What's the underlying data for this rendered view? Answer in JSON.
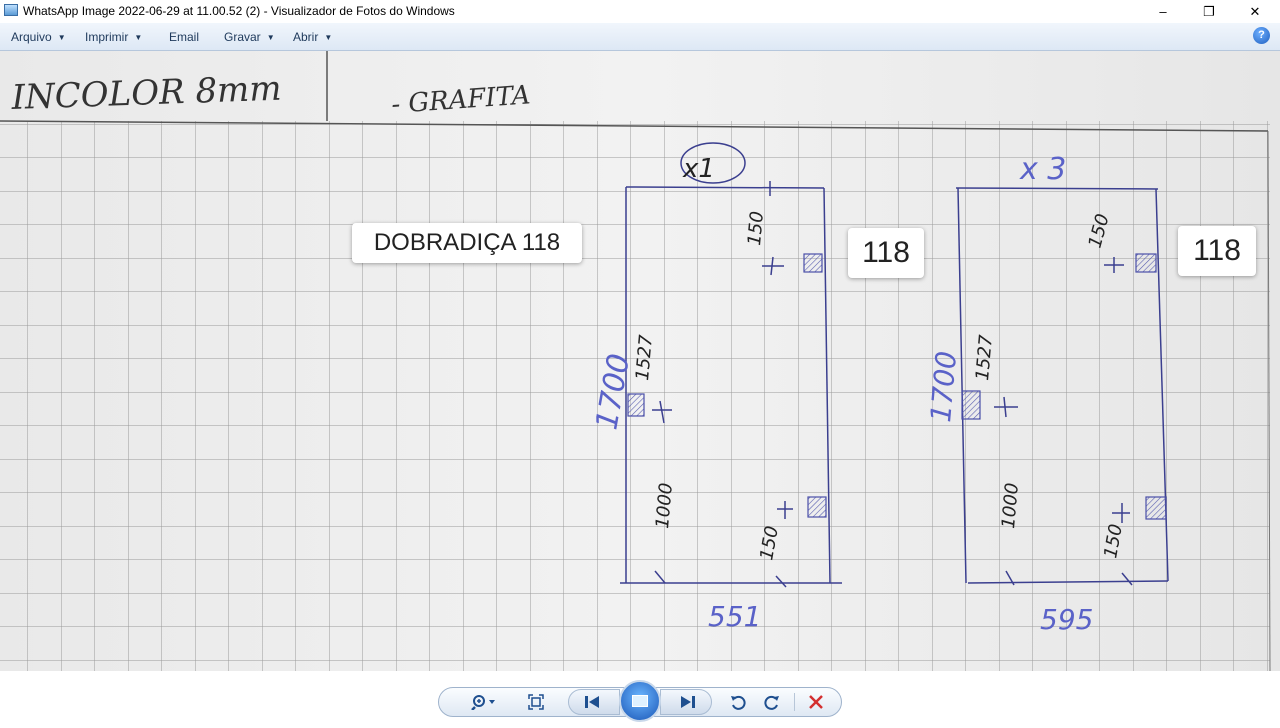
{
  "window": {
    "title": "WhatsApp Image 2022-06-29 at 11.00.52 (2) - Visualizador de Fotos do Windows",
    "minimize_glyph": "–",
    "maximize_glyph": "❐",
    "close_glyph": "✕"
  },
  "menu": {
    "items": [
      {
        "label": "Arquivo",
        "has_arrow": true
      },
      {
        "label": "Imprimir",
        "has_arrow": true
      },
      {
        "label": "Email",
        "has_arrow": false
      },
      {
        "label": "Gravar",
        "has_arrow": true
      },
      {
        "label": "Abrir",
        "has_arrow": true
      }
    ],
    "help_label": "?"
  },
  "photo": {
    "handwriting": {
      "header_left": "INCOLOR 8mm",
      "header_right": "- GRAFITA",
      "qty_left": "x1",
      "qty_right": "x 3",
      "left_panel": {
        "height": "1700",
        "width": "551",
        "dim_top": "150",
        "dim_mid": "1527",
        "dim_low": "1000",
        "dim_bottom": "150"
      },
      "right_panel": {
        "height": "1700",
        "width": "595",
        "dim_top": "150",
        "dim_mid": "1527",
        "dim_low": "1000",
        "dim_bottom": "150"
      }
    },
    "labels": {
      "hinge": "DOBRADIÇA 118",
      "hinge_code_left": "118",
      "hinge_code_right": "118"
    }
  },
  "controls": {
    "zoom_icon": "zoom-icon",
    "actual_size_icon": "fit-window-icon",
    "previous_icon": "previous-icon",
    "slideshow_icon": "slideshow-icon",
    "next_icon": "next-icon",
    "rotate_ccw_icon": "rotate-counterclockwise-icon",
    "rotate_cw_icon": "rotate-clockwise-icon",
    "delete_icon": "delete-icon",
    "accent_color": "#1e4f8f",
    "delete_color": "#d32f2f"
  }
}
